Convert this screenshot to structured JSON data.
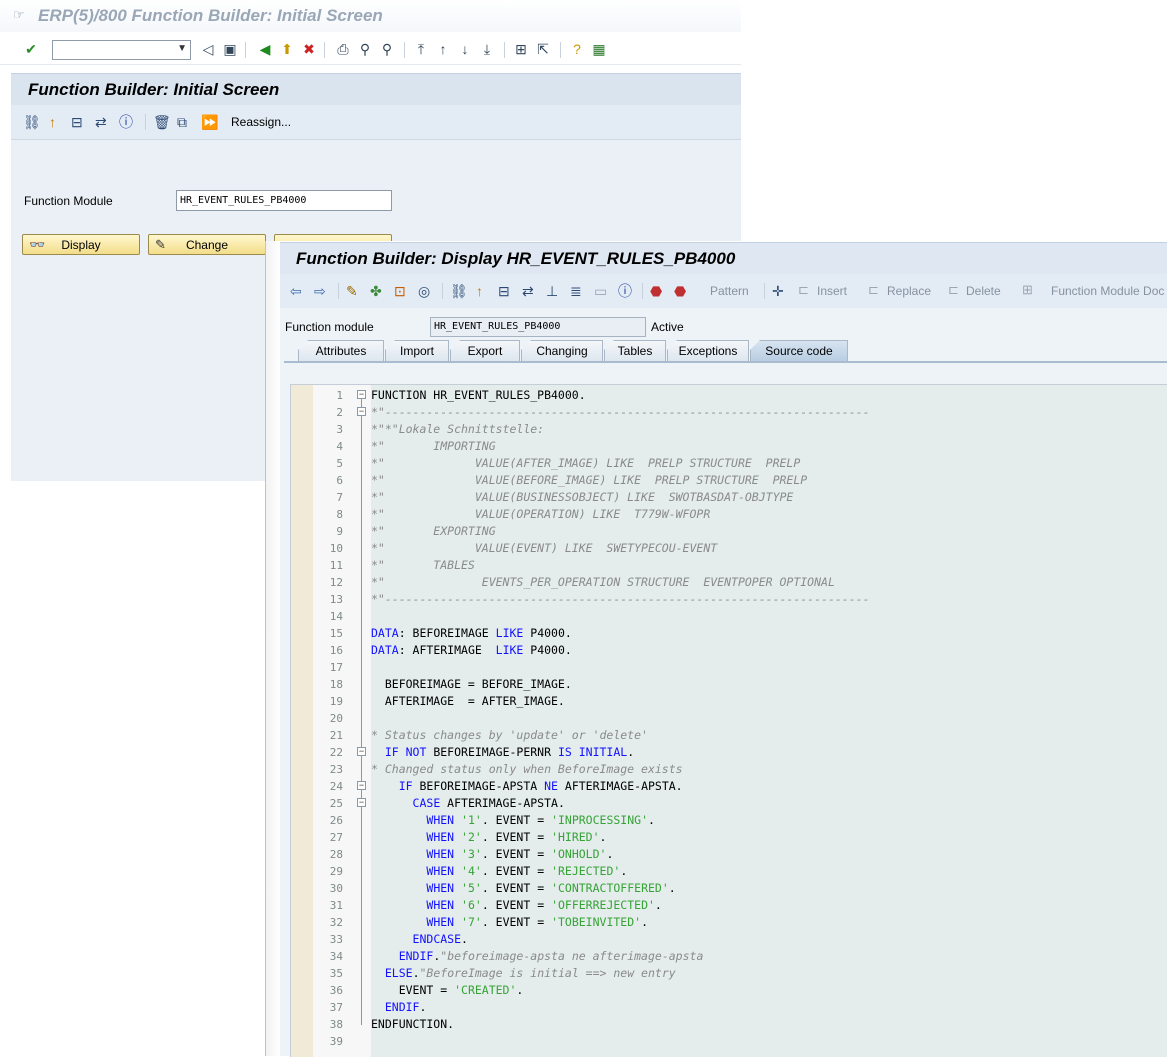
{
  "back_window": {
    "title": "ERP(5)/800 Function Builder: Initial Screen",
    "header": "Function Builder: Initial Screen",
    "reassign_label": "Reassign...",
    "function_module_label": "Function Module",
    "function_module_value": "HR_EVENT_RULES_PB4000",
    "display_label": "Display",
    "change_label": "Change"
  },
  "front_window": {
    "header": "Function Builder: Display HR_EVENT_RULES_PB4000",
    "toolbar": {
      "pattern": "Pattern",
      "insert": "Insert",
      "replace": "Replace",
      "delete": "Delete",
      "fm_doc": "Function Module Doc"
    },
    "function_module_label": "Function module",
    "function_module_value": "HR_EVENT_RULES_PB4000",
    "status": "Active",
    "tabs": [
      "Attributes",
      "Import",
      "Export",
      "Changing",
      "Tables",
      "Exceptions",
      "Source code"
    ],
    "active_tab": "Source code"
  },
  "code_lines": [
    [
      {
        "t": "FUNCTION HR_EVENT_RULES_PB4000.",
        "c": "pl"
      }
    ],
    [
      {
        "t": "*\"----------------------------------------------------------------------",
        "c": "cm"
      }
    ],
    [
      {
        "t": "*\"*\"Lokale Schnittstelle:",
        "c": "cm"
      }
    ],
    [
      {
        "t": "*\"       IMPORTING",
        "c": "cm"
      }
    ],
    [
      {
        "t": "*\"             VALUE(AFTER_IMAGE) LIKE  PRELP STRUCTURE  PRELP",
        "c": "cm"
      }
    ],
    [
      {
        "t": "*\"             VALUE(BEFORE_IMAGE) LIKE  PRELP STRUCTURE  PRELP",
        "c": "cm"
      }
    ],
    [
      {
        "t": "*\"             VALUE(BUSINESSOBJECT) LIKE  SWOTBASDAT-OBJTYPE",
        "c": "cm"
      }
    ],
    [
      {
        "t": "*\"             VALUE(OPERATION) LIKE  T779W-WFOPR",
        "c": "cm"
      }
    ],
    [
      {
        "t": "*\"       EXPORTING",
        "c": "cm"
      }
    ],
    [
      {
        "t": "*\"             VALUE(EVENT) LIKE  SWETYPECOU-EVENT",
        "c": "cm"
      }
    ],
    [
      {
        "t": "*\"       TABLES",
        "c": "cm"
      }
    ],
    [
      {
        "t": "*\"              EVENTS_PER_OPERATION STRUCTURE  EVENTPOPER OPTIONAL",
        "c": "cm"
      }
    ],
    [
      {
        "t": "*\"----------------------------------------------------------------------",
        "c": "cm"
      }
    ],
    [],
    [
      {
        "t": "DATA",
        "c": "kw"
      },
      {
        "t": ": BEFOREIMAGE ",
        "c": "pl"
      },
      {
        "t": "LIKE",
        "c": "kw"
      },
      {
        "t": " P4000.",
        "c": "pl"
      }
    ],
    [
      {
        "t": "DATA",
        "c": "kw"
      },
      {
        "t": ": AFTERIMAGE  ",
        "c": "pl"
      },
      {
        "t": "LIKE",
        "c": "kw"
      },
      {
        "t": " P4000.",
        "c": "pl"
      }
    ],
    [],
    [
      {
        "t": "  BEFOREIMAGE = BEFORE_IMAGE.",
        "c": "pl"
      }
    ],
    [
      {
        "t": "  AFTERIMAGE  = AFTER_IMAGE.",
        "c": "pl"
      }
    ],
    [],
    [
      {
        "t": "* Status changes by 'update' or 'delete'",
        "c": "cm"
      }
    ],
    [
      {
        "t": "  ",
        "c": "pl"
      },
      {
        "t": "IF NOT",
        "c": "kw"
      },
      {
        "t": " BEFOREIMAGE-PERNR ",
        "c": "pl"
      },
      {
        "t": "IS INITIAL",
        "c": "kw"
      },
      {
        "t": ".",
        "c": "pl"
      }
    ],
    [
      {
        "t": "* Changed status only when BeforeImage exists",
        "c": "cm"
      }
    ],
    [
      {
        "t": "    ",
        "c": "pl"
      },
      {
        "t": "IF",
        "c": "kw"
      },
      {
        "t": " BEFOREIMAGE-APSTA ",
        "c": "pl"
      },
      {
        "t": "NE",
        "c": "kw"
      },
      {
        "t": " AFTERIMAGE-APSTA.",
        "c": "pl"
      }
    ],
    [
      {
        "t": "      ",
        "c": "pl"
      },
      {
        "t": "CASE",
        "c": "kw"
      },
      {
        "t": " AFTERIMAGE-APSTA.",
        "c": "pl"
      }
    ],
    [
      {
        "t": "        ",
        "c": "pl"
      },
      {
        "t": "WHEN",
        "c": "kw"
      },
      {
        "t": " ",
        "c": "pl"
      },
      {
        "t": "'1'",
        "c": "st"
      },
      {
        "t": ". EVENT = ",
        "c": "pl"
      },
      {
        "t": "'INPROCESSING'",
        "c": "st"
      },
      {
        "t": ".",
        "c": "pl"
      }
    ],
    [
      {
        "t": "        ",
        "c": "pl"
      },
      {
        "t": "WHEN",
        "c": "kw"
      },
      {
        "t": " ",
        "c": "pl"
      },
      {
        "t": "'2'",
        "c": "st"
      },
      {
        "t": ". EVENT = ",
        "c": "pl"
      },
      {
        "t": "'HIRED'",
        "c": "st"
      },
      {
        "t": ".",
        "c": "pl"
      }
    ],
    [
      {
        "t": "        ",
        "c": "pl"
      },
      {
        "t": "WHEN",
        "c": "kw"
      },
      {
        "t": " ",
        "c": "pl"
      },
      {
        "t": "'3'",
        "c": "st"
      },
      {
        "t": ". EVENT = ",
        "c": "pl"
      },
      {
        "t": "'ONHOLD'",
        "c": "st"
      },
      {
        "t": ".",
        "c": "pl"
      }
    ],
    [
      {
        "t": "        ",
        "c": "pl"
      },
      {
        "t": "WHEN",
        "c": "kw"
      },
      {
        "t": " ",
        "c": "pl"
      },
      {
        "t": "'4'",
        "c": "st"
      },
      {
        "t": ". EVENT = ",
        "c": "pl"
      },
      {
        "t": "'REJECTED'",
        "c": "st"
      },
      {
        "t": ".",
        "c": "pl"
      }
    ],
    [
      {
        "t": "        ",
        "c": "pl"
      },
      {
        "t": "WHEN",
        "c": "kw"
      },
      {
        "t": " ",
        "c": "pl"
      },
      {
        "t": "'5'",
        "c": "st"
      },
      {
        "t": ". EVENT = ",
        "c": "pl"
      },
      {
        "t": "'CONTRACTOFFERED'",
        "c": "st"
      },
      {
        "t": ".",
        "c": "pl"
      }
    ],
    [
      {
        "t": "        ",
        "c": "pl"
      },
      {
        "t": "WHEN",
        "c": "kw"
      },
      {
        "t": " ",
        "c": "pl"
      },
      {
        "t": "'6'",
        "c": "st"
      },
      {
        "t": ". EVENT = ",
        "c": "pl"
      },
      {
        "t": "'OFFERREJECTED'",
        "c": "st"
      },
      {
        "t": ".",
        "c": "pl"
      }
    ],
    [
      {
        "t": "        ",
        "c": "pl"
      },
      {
        "t": "WHEN",
        "c": "kw"
      },
      {
        "t": " ",
        "c": "pl"
      },
      {
        "t": "'7'",
        "c": "st"
      },
      {
        "t": ". EVENT = ",
        "c": "pl"
      },
      {
        "t": "'TOBEINVITED'",
        "c": "st"
      },
      {
        "t": ".",
        "c": "pl"
      }
    ],
    [
      {
        "t": "      ",
        "c": "pl"
      },
      {
        "t": "ENDCASE",
        "c": "kw"
      },
      {
        "t": ".",
        "c": "pl"
      }
    ],
    [
      {
        "t": "    ",
        "c": "pl"
      },
      {
        "t": "ENDIF",
        "c": "kw"
      },
      {
        "t": ".",
        "c": "pl"
      },
      {
        "t": "\"beforeimage-apsta ne afterimage-apsta",
        "c": "cm"
      }
    ],
    [
      {
        "t": "  ",
        "c": "pl"
      },
      {
        "t": "ELSE",
        "c": "kw"
      },
      {
        "t": ".",
        "c": "pl"
      },
      {
        "t": "\"BeforeImage is initial ==> new entry",
        "c": "cm"
      }
    ],
    [
      {
        "t": "    EVENT = ",
        "c": "pl"
      },
      {
        "t": "'CREATED'",
        "c": "st"
      },
      {
        "t": ".",
        "c": "pl"
      }
    ],
    [
      {
        "t": "  ",
        "c": "pl"
      },
      {
        "t": "ENDIF",
        "c": "kw"
      },
      {
        "t": ".",
        "c": "pl"
      }
    ],
    [
      {
        "t": "ENDFUNCTION.",
        "c": "pl"
      }
    ],
    []
  ],
  "fold_boxes": [
    "1",
    "2",
    "22",
    "24",
    "25"
  ],
  "colors": {
    "keyword": "#1111ff",
    "string": "#36a336",
    "comment": "#8a8a8a"
  }
}
